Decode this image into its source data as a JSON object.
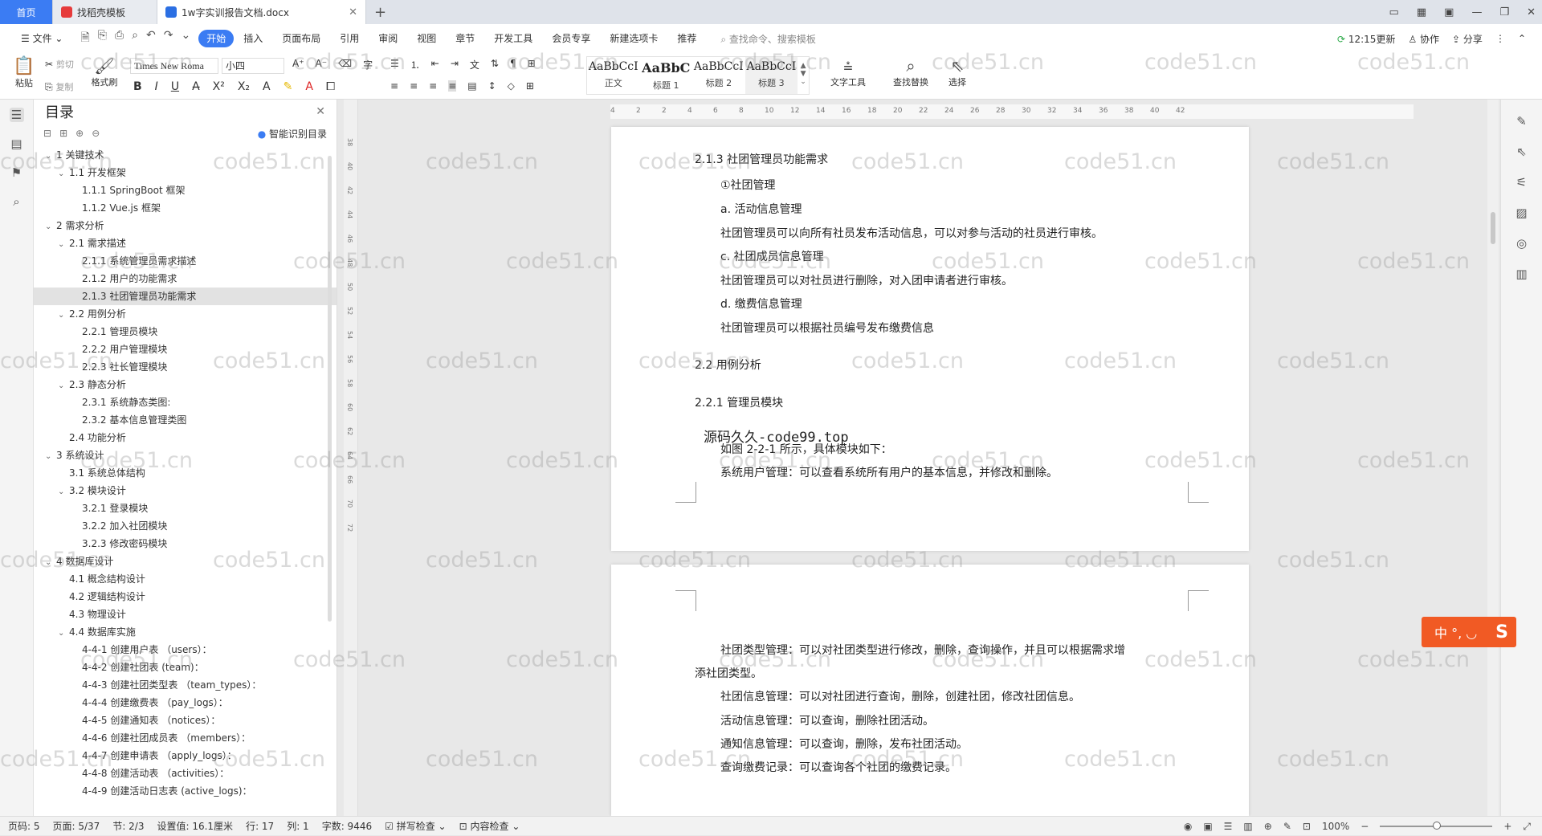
{
  "tabs": [
    {
      "label": "首页"
    },
    {
      "label": "找稻壳模板"
    },
    {
      "label": "1w字实训报告文档.docx"
    }
  ],
  "menu": {
    "file": "文件",
    "items": [
      "开始",
      "插入",
      "页面布局",
      "引用",
      "审阅",
      "视图",
      "章节",
      "开发工具",
      "会员专享",
      "新建选项卡",
      "推荐"
    ],
    "search": "查找命令、搜索模板",
    "update": "12:15更新",
    "collab": "协作",
    "share": "分享"
  },
  "ribbon": {
    "paste": "粘贴",
    "cut": "剪切",
    "copy": "复制",
    "format_painter": "格式刷",
    "font": "Times New Roma",
    "size": "小四",
    "styles": [
      {
        "sample": "AaBbCcI",
        "label": "正文"
      },
      {
        "sample": "AaBbC",
        "label": "标题 1"
      },
      {
        "sample": "AaBbCcI",
        "label": "标题 2"
      },
      {
        "sample": "AaBbCcI",
        "label": "标题 3"
      }
    ],
    "text_tools": "文字工具",
    "find_replace": "查找替换",
    "select": "选择"
  },
  "toc": {
    "title": "目录",
    "smart": "智能识别目录",
    "items": [
      {
        "text": "1  关键技术",
        "level": 0,
        "open": true
      },
      {
        "text": "1.1  开发框架",
        "level": 1,
        "open": true
      },
      {
        "text": "1.1.1 SpringBoot  框架",
        "level": 2
      },
      {
        "text": "1.1.2 Vue.js  框架",
        "level": 2
      },
      {
        "text": "2  需求分析",
        "level": 0,
        "open": true
      },
      {
        "text": "2.1 需求描述",
        "level": 1,
        "open": true
      },
      {
        "text": "2.1.1 系统管理员需求描述",
        "level": 2
      },
      {
        "text": "2.1.2 用户的功能需求",
        "level": 2
      },
      {
        "text": "2.1.3 社团管理员功能需求",
        "level": 2,
        "selected": true
      },
      {
        "text": "2.2 用例分析",
        "level": 1,
        "open": true
      },
      {
        "text": "2.2.1 管理员模块",
        "level": 2
      },
      {
        "text": "2.2.2 用户管理模块",
        "level": 2
      },
      {
        "text": "2.2.3 社长管理模块",
        "level": 2
      },
      {
        "text": "2.3 静态分析",
        "level": 1,
        "open": true
      },
      {
        "text": "2.3.1 系统静态类图:",
        "level": 2
      },
      {
        "text": "2.3.2 基本信息管理类图",
        "level": 2
      },
      {
        "text": "2.4 功能分析",
        "level": 1
      },
      {
        "text": "3  系统设计",
        "level": 0,
        "open": true
      },
      {
        "text": "3.1 系统总体结构",
        "level": 1
      },
      {
        "text": "3.2 模块设计",
        "level": 1,
        "open": true
      },
      {
        "text": "3.2.1 登录模块",
        "level": 2
      },
      {
        "text": "3.2.2 加入社团模块",
        "level": 2
      },
      {
        "text": "3.2.3 修改密码模块",
        "level": 2
      },
      {
        "text": "4  数据库设计",
        "level": 0,
        "open": true
      },
      {
        "text": "4.1 概念结构设计",
        "level": 1
      },
      {
        "text": "4.2 逻辑结构设计",
        "level": 1
      },
      {
        "text": "4.3 物理设计",
        "level": 1
      },
      {
        "text": "4.4  数据库实施",
        "level": 1,
        "open": true
      },
      {
        "text": "4-4-1 创建用户表  （users）：",
        "level": 2
      },
      {
        "text": "4-4-2 创建社团表  (team)：",
        "level": 2
      },
      {
        "text": "4-4-3 创建社团类型表  （team_types）：",
        "level": 2
      },
      {
        "text": "4-4-4 创建缴费表  （pay_logs）：",
        "level": 2
      },
      {
        "text": "4-4-5 创建通知表  （notices）：",
        "level": 2
      },
      {
        "text": "4-4-6 创建社团成员表  （members）：",
        "level": 2
      },
      {
        "text": "4-4-7 创建申请表  （apply_logs）：",
        "level": 2
      },
      {
        "text": "4-4-8 创建活动表  （activities）：",
        "level": 2
      },
      {
        "text": "4-4-9 创建活动日志表  (active_logs)：",
        "level": 2
      }
    ]
  },
  "page1": [
    "2.1.3 社团管理员功能需求",
    "①社团管理",
    "a.  活动信息管理",
    "社团管理员可以向所有社员发布活动信息，可以对参与活动的社员进行审核。",
    "c.  社团成员信息管理",
    "社团管理员可以对社员进行删除，对入团申请者进行审核。",
    "d.  缴费信息管理",
    "社团管理员可以根据社员编号发布缴费信息",
    "2.2 用例分析",
    "2.2.1 管理员模块",
    "源码久久-code99.top",
    "如图 2-2-1 所示，具体模块如下：",
    "系统用户管理：可以查看系统所有用户的基本信息，并修改和删除。"
  ],
  "page2": [
    "社团类型管理：可以对社团类型进行修改，删除，查询操作，并且可以根据需求增",
    "添社团类型。",
    "社团信息管理：可以对社团进行查询，删除，创建社团，修改社团信息。",
    "活动信息管理：可以查询，删除社团活动。",
    "通知信息管理：可以查询，删除，发布社团活动。",
    "查询缴费记录：可以查询各个社团的缴费记录。"
  ],
  "watermark": "code51.cn",
  "ruler_numbers": [
    "4",
    "2",
    "2",
    "4",
    "6",
    "8",
    "10",
    "12",
    "14",
    "16",
    "18",
    "20",
    "22",
    "24",
    "26",
    "28",
    "30",
    "32",
    "34",
    "36",
    "38",
    "40",
    "42"
  ],
  "vruler_numbers": [
    "38",
    "40",
    "42",
    "44",
    "46",
    "48",
    "50",
    "52",
    "54",
    "56",
    "58",
    "60",
    "62",
    "64",
    "66",
    "70",
    "72"
  ],
  "status": {
    "page_no": "页码: 5",
    "page": "页面: 5/37",
    "section": "节: 2/3",
    "setting": "设置值: 16.1厘米",
    "row": "行: 17",
    "col": "列: 1",
    "words": "字数: 9446",
    "spell": "拼写检查",
    "content": "内容检查",
    "zoom": "100%"
  },
  "ime": {
    "label": "中 °, ◡"
  },
  "colors": {
    "accent": "#3b7cf3",
    "ime": "#f15a24"
  }
}
